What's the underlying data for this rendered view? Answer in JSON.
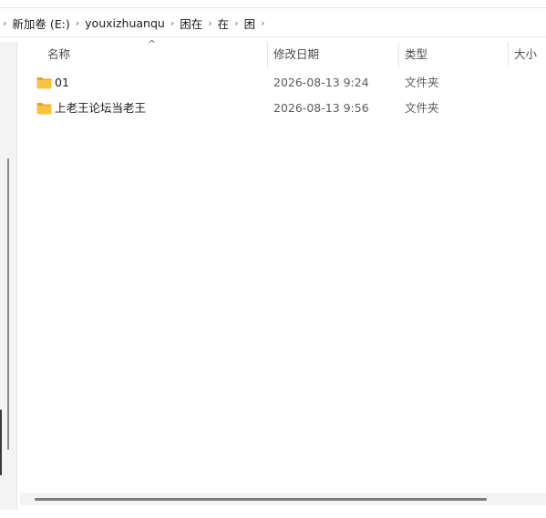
{
  "breadcrumb": {
    "items": [
      {
        "label": "新加卷 (E:)"
      },
      {
        "label": "youxizhuanqu"
      },
      {
        "label": "困在"
      },
      {
        "label": "在"
      },
      {
        "label": "困"
      }
    ],
    "separator": "›"
  },
  "columns": {
    "name": "名称",
    "date_modified": "修改日期",
    "type": "类型",
    "size": "大小",
    "sort_indicator": "^"
  },
  "files": [
    {
      "name": "01",
      "date_modified": "2026-08-13 9:24",
      "type": "文件夹",
      "icon": "folder-icon"
    },
    {
      "name": "上老王论坛当老王",
      "date_modified": "2026-08-13 9:56",
      "type": "文件夹",
      "icon": "folder-icon"
    }
  ],
  "colors": {
    "folder_body": "#F8C440",
    "folder_tab": "#E0A526",
    "border": "#E5E5E5",
    "scrollbar_track": "#F3F3F3",
    "scrollbar_thumb": "#7A7A7A"
  }
}
